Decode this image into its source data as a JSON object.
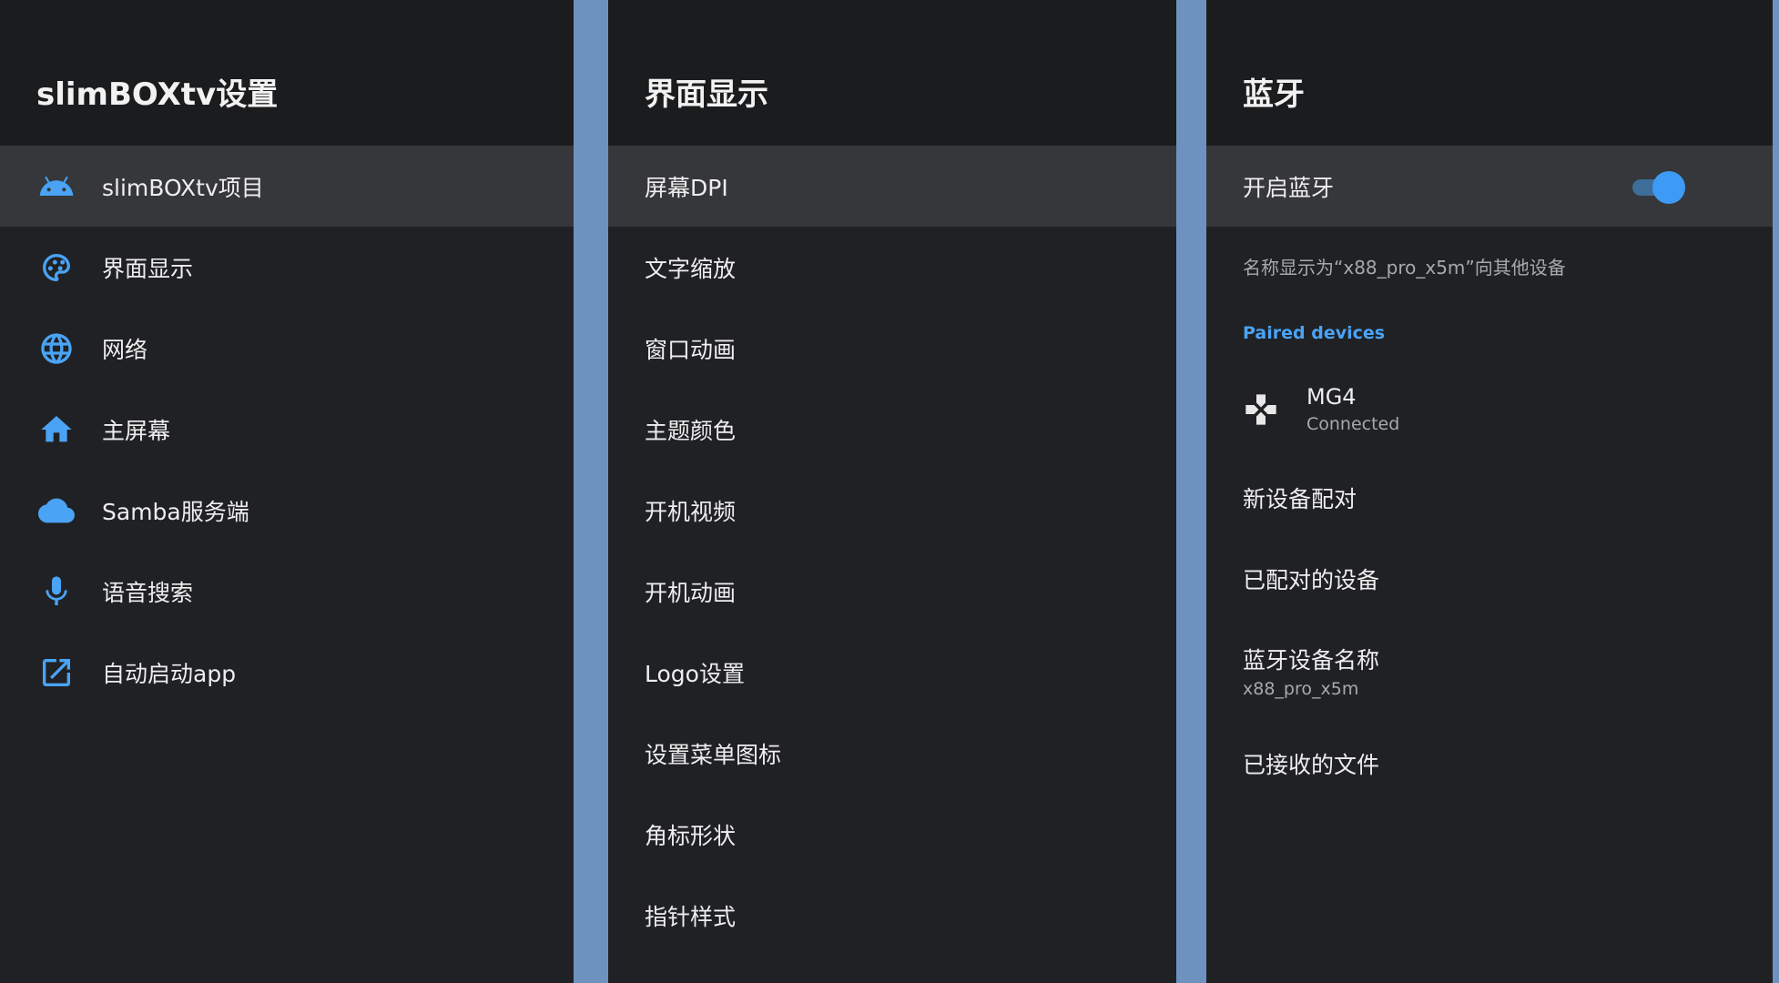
{
  "main_panel": {
    "title": "slimBOXtv设置",
    "items": [
      {
        "label": "slimBOXtv项目",
        "icon": "android-icon"
      },
      {
        "label": "界面显示",
        "icon": "palette-icon"
      },
      {
        "label": "网络",
        "icon": "globe-icon"
      },
      {
        "label": "主屏幕",
        "icon": "home-icon"
      },
      {
        "label": "Samba服务端",
        "icon": "cloud-icon"
      },
      {
        "label": "语音搜索",
        "icon": "mic-icon"
      },
      {
        "label": "自动启动app",
        "icon": "open-in-new-icon"
      }
    ]
  },
  "display_panel": {
    "title": "界面显示",
    "items": [
      {
        "label": "屏幕DPI"
      },
      {
        "label": "文字缩放"
      },
      {
        "label": "窗口动画"
      },
      {
        "label": "主题颜色"
      },
      {
        "label": "开机视频"
      },
      {
        "label": "开机动画"
      },
      {
        "label": "Logo设置"
      },
      {
        "label": "设置菜单图标"
      },
      {
        "label": "角标形状"
      },
      {
        "label": "指针样式"
      }
    ]
  },
  "bluetooth_panel": {
    "title": "蓝牙",
    "enable_label": "开启蓝牙",
    "enabled": true,
    "visibility_text": "名称显示为“x88_pro_x5m”向其他设备",
    "paired_section_label": "Paired devices",
    "paired_device": {
      "name": "MG4",
      "status": "Connected",
      "icon": "gamepad-icon"
    },
    "pair_new_label": "新设备配对",
    "paired_list_label": "已配对的设备",
    "device_name_label": "蓝牙设备名称",
    "device_name_value": "x88_pro_x5m",
    "received_files_label": "已接收的文件"
  },
  "colors": {
    "accent": "#4aa3f5",
    "panel_bg": "#202124",
    "header_bg": "#1b1c1e",
    "selected_bg": "#36373a",
    "backdrop": "#6e92bf"
  }
}
